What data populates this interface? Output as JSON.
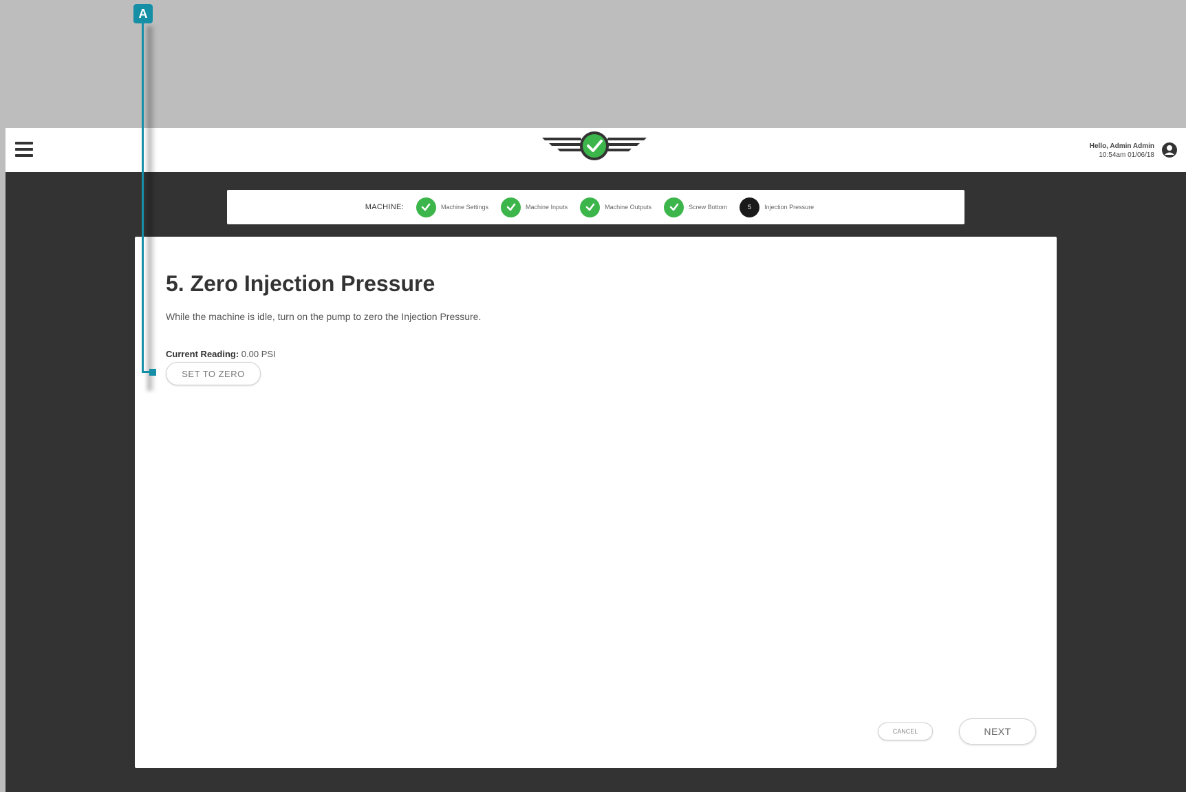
{
  "header": {
    "user_greeting": "Hello, Admin Admin",
    "user_timestamp": "10:54am 01/06/18"
  },
  "wizard": {
    "section_label": "MACHINE:",
    "steps": [
      {
        "label": "Machine Settings",
        "status": "complete"
      },
      {
        "label": "Machine Inputs",
        "status": "complete"
      },
      {
        "label": "Machine Outputs",
        "status": "complete"
      },
      {
        "label": "Screw Bottom",
        "status": "complete"
      },
      {
        "label": "Injection Pressure",
        "status": "current",
        "number": "5"
      }
    ]
  },
  "main": {
    "title": "5. Zero Injection Pressure",
    "description": "While the machine is idle, turn on the pump to zero the Injection Pressure.",
    "reading_label": "Current Reading:",
    "reading_value": "0.00 PSI",
    "zero_button": "SET TO ZERO",
    "cancel_button": "CANCEL",
    "next_button": "NEXT"
  },
  "callout": {
    "letter": "A"
  },
  "colors": {
    "accent_green": "#3cb54a",
    "callout_teal": "#158fa6",
    "dark_bg": "#333333"
  },
  "icons": [
    "hamburger-menu-icon",
    "logo-check-wings-icon",
    "user-account-icon",
    "checkmark-icon"
  ]
}
